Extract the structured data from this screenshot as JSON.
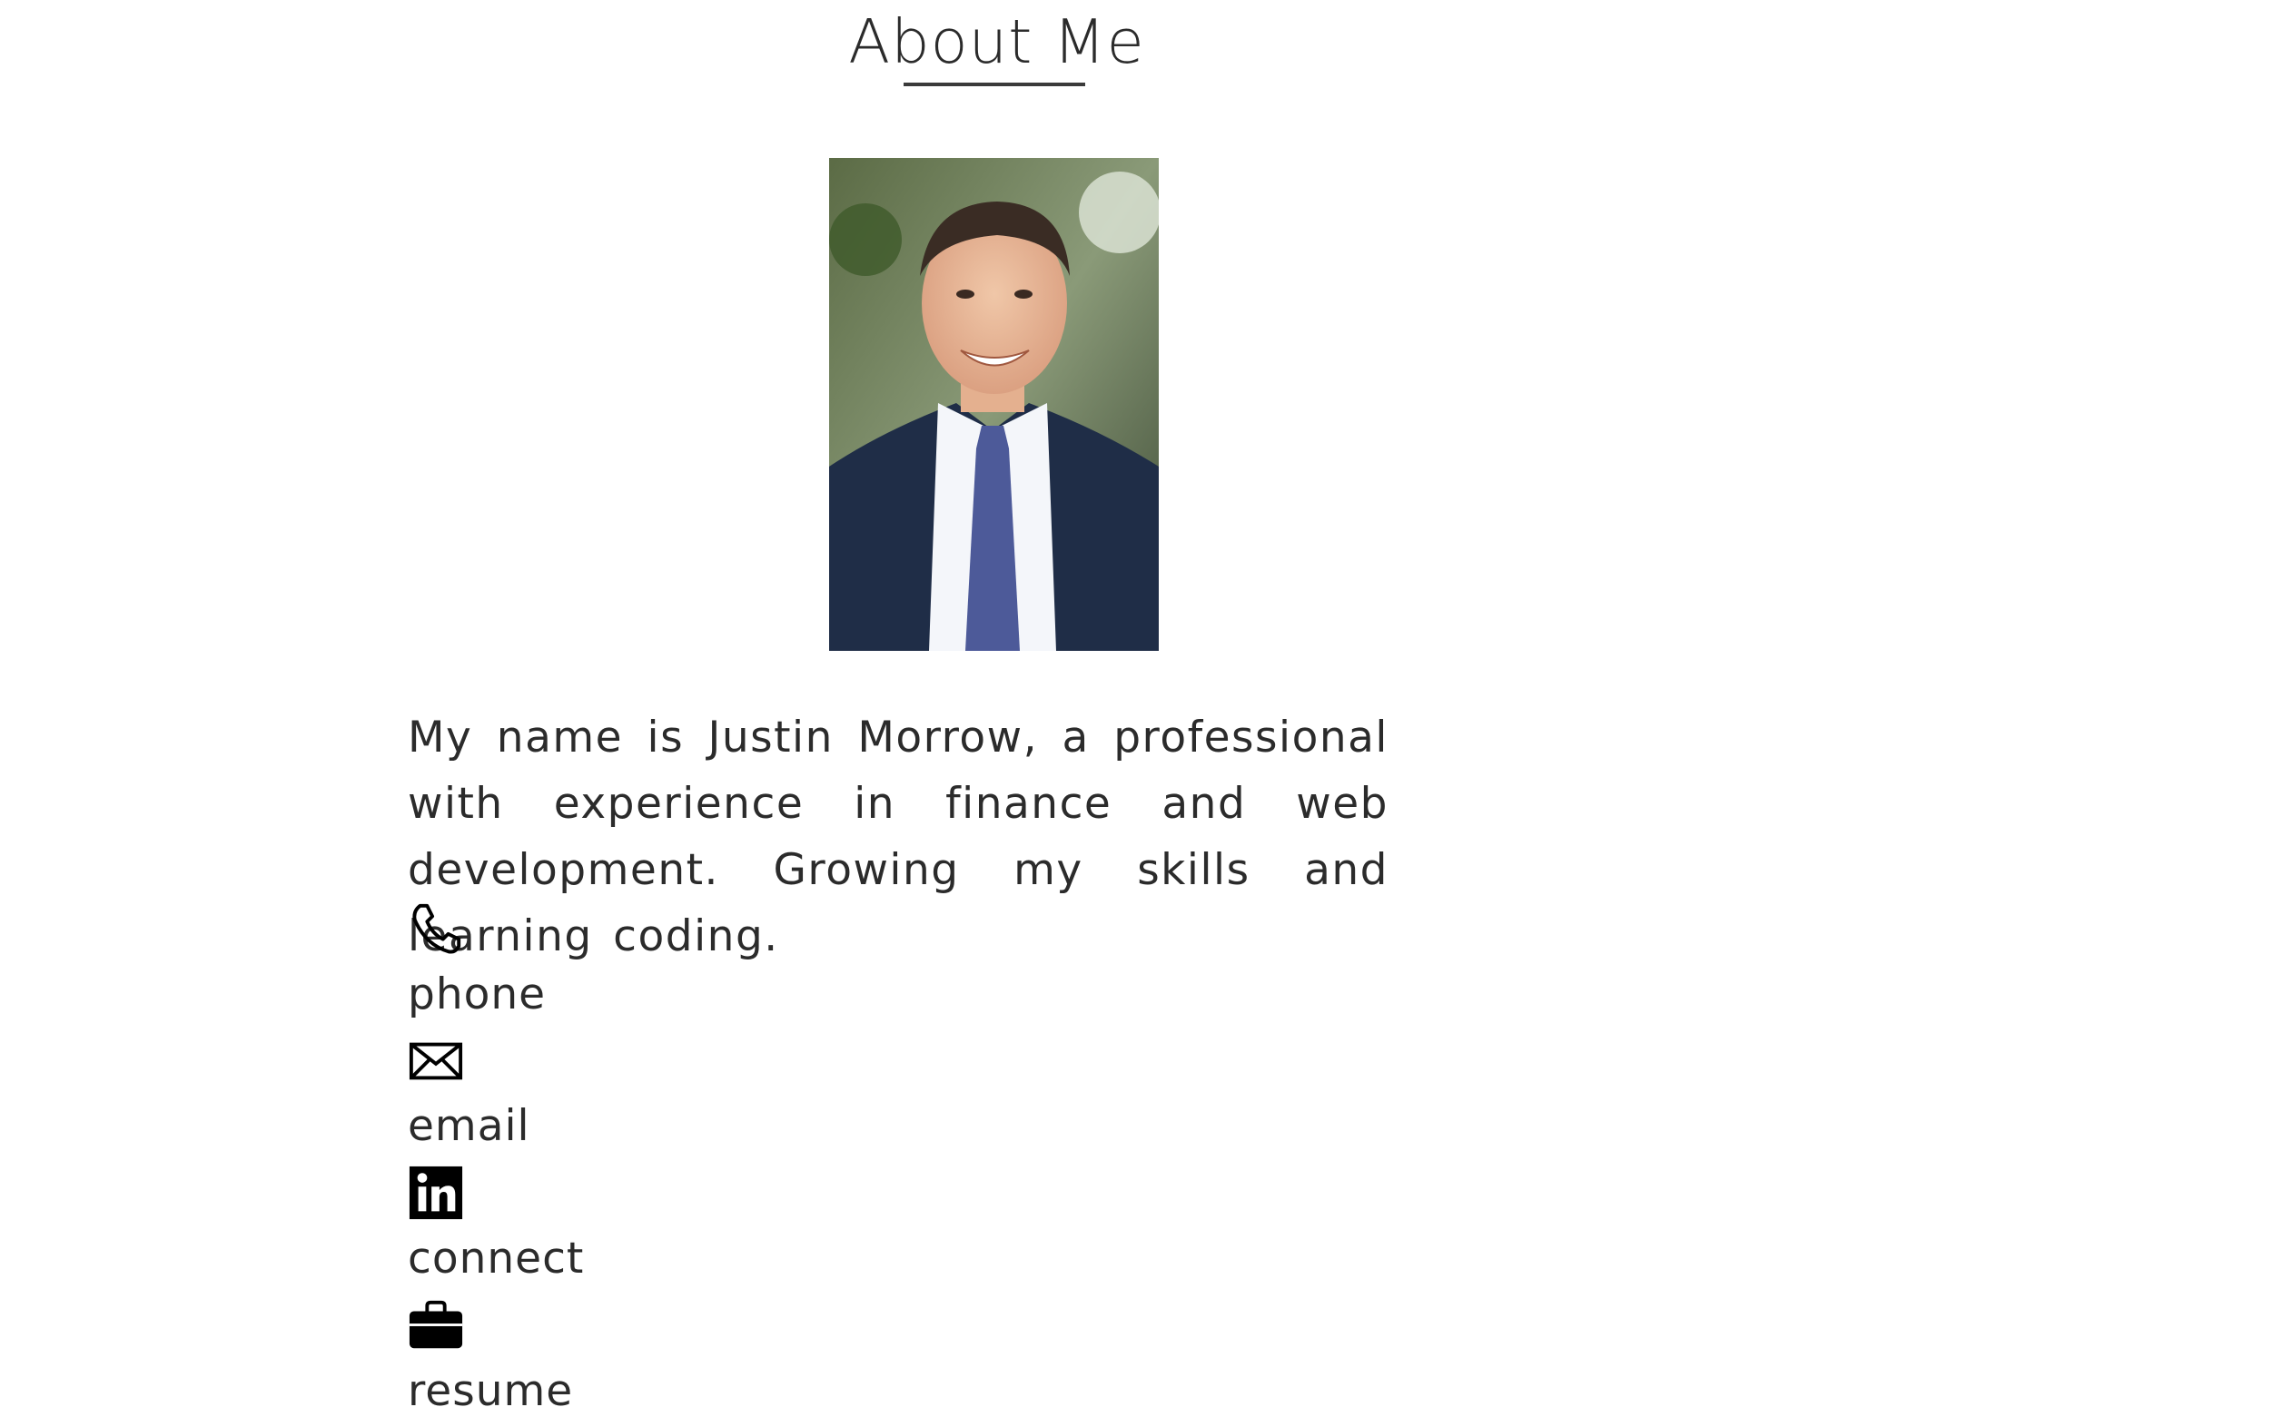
{
  "header": {
    "title": "About Me"
  },
  "profile": {
    "photo_icon": "portrait-photo",
    "bio": "My name is Justin Morrow, a professional with experience in finance and web development. Growing my skills and learning coding."
  },
  "contacts": [
    {
      "icon": "phone-icon",
      "label": "phone"
    },
    {
      "icon": "envelope-icon",
      "label": "email"
    },
    {
      "icon": "linkedin-icon",
      "label": "connect"
    },
    {
      "icon": "briefcase-icon",
      "label": "resume"
    }
  ],
  "colors": {
    "text": "#2b2b2b",
    "background": "#ffffff",
    "icon": "#000000"
  }
}
